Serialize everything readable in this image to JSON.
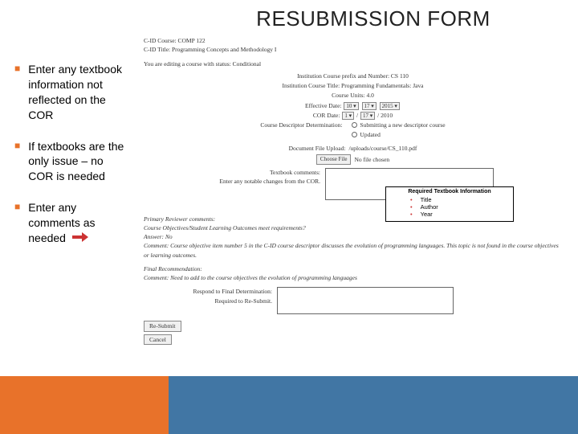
{
  "title": "RESUBMISSION FORM",
  "bullets": [
    {
      "text": "Enter any textbook information not reflected on the COR"
    },
    {
      "text": "If textbooks are the only issue – no COR is needed"
    },
    {
      "text": "Enter any comments as needed"
    }
  ],
  "hdr": {
    "l1": "C-ID Course: COMP 122",
    "l2": "C-ID Title: Programming Concepts and Methodology I",
    "l3": "You are editing a course with status: Conditional"
  },
  "inst": {
    "prefix": "Institution Course prefix and Number: CS 110",
    "title_lbl": "Institution Course Title:",
    "title_val": "Programming Fundamentals: Java",
    "units_lbl": "Course Units:",
    "units_val": "4.0",
    "eff_lbl": "Effective Date:",
    "eff_m": "10",
    "eff_d": "17",
    "eff_y": "2015",
    "cor_lbl": "COR Date:",
    "cor_m": "1",
    "cor_d": "17",
    "cor_y": "2010",
    "desc_lbl": "Course Descriptor Determination:",
    "desc_opt1": "Submitting a new descriptor course",
    "desc_opt2": "Updated"
  },
  "upload": {
    "lbl": "Document File Upload:",
    "path": "/uploads/course/CS_110.pdf",
    "choose": "Choose File",
    "none": "No file chosen"
  },
  "tb": {
    "lbl1": "Textbook comments:",
    "lbl2": "Enter any notable changes from the COR."
  },
  "req": {
    "title": "Required Textbook Information",
    "i1": "Title",
    "i2": "Author",
    "i3": "Year"
  },
  "rev": {
    "hdr": "Primary Reviewer comments:",
    "q": "Course Objectives/Student Learning Outcomes meet requirements?",
    "a_lbl": "Answer:",
    "a_val": "No",
    "c_lbl": "Comment:",
    "c_val": "Course objective item number 5 in the C-ID course descriptor discusses the evolution of programming languages. This topic is not found in the course objectives or learning outcomes.",
    "rec": "Final Recommendation:",
    "rec_c_lbl": "Comment:",
    "rec_c_val": "Need to add to the course objectives the evolution of programming languages"
  },
  "final": {
    "lbl1": "Respond to Final Determination:",
    "lbl2": "Required to Re-Submit."
  },
  "buttons": {
    "resubmit": "Re-Submit",
    "cancel": "Cancel"
  }
}
